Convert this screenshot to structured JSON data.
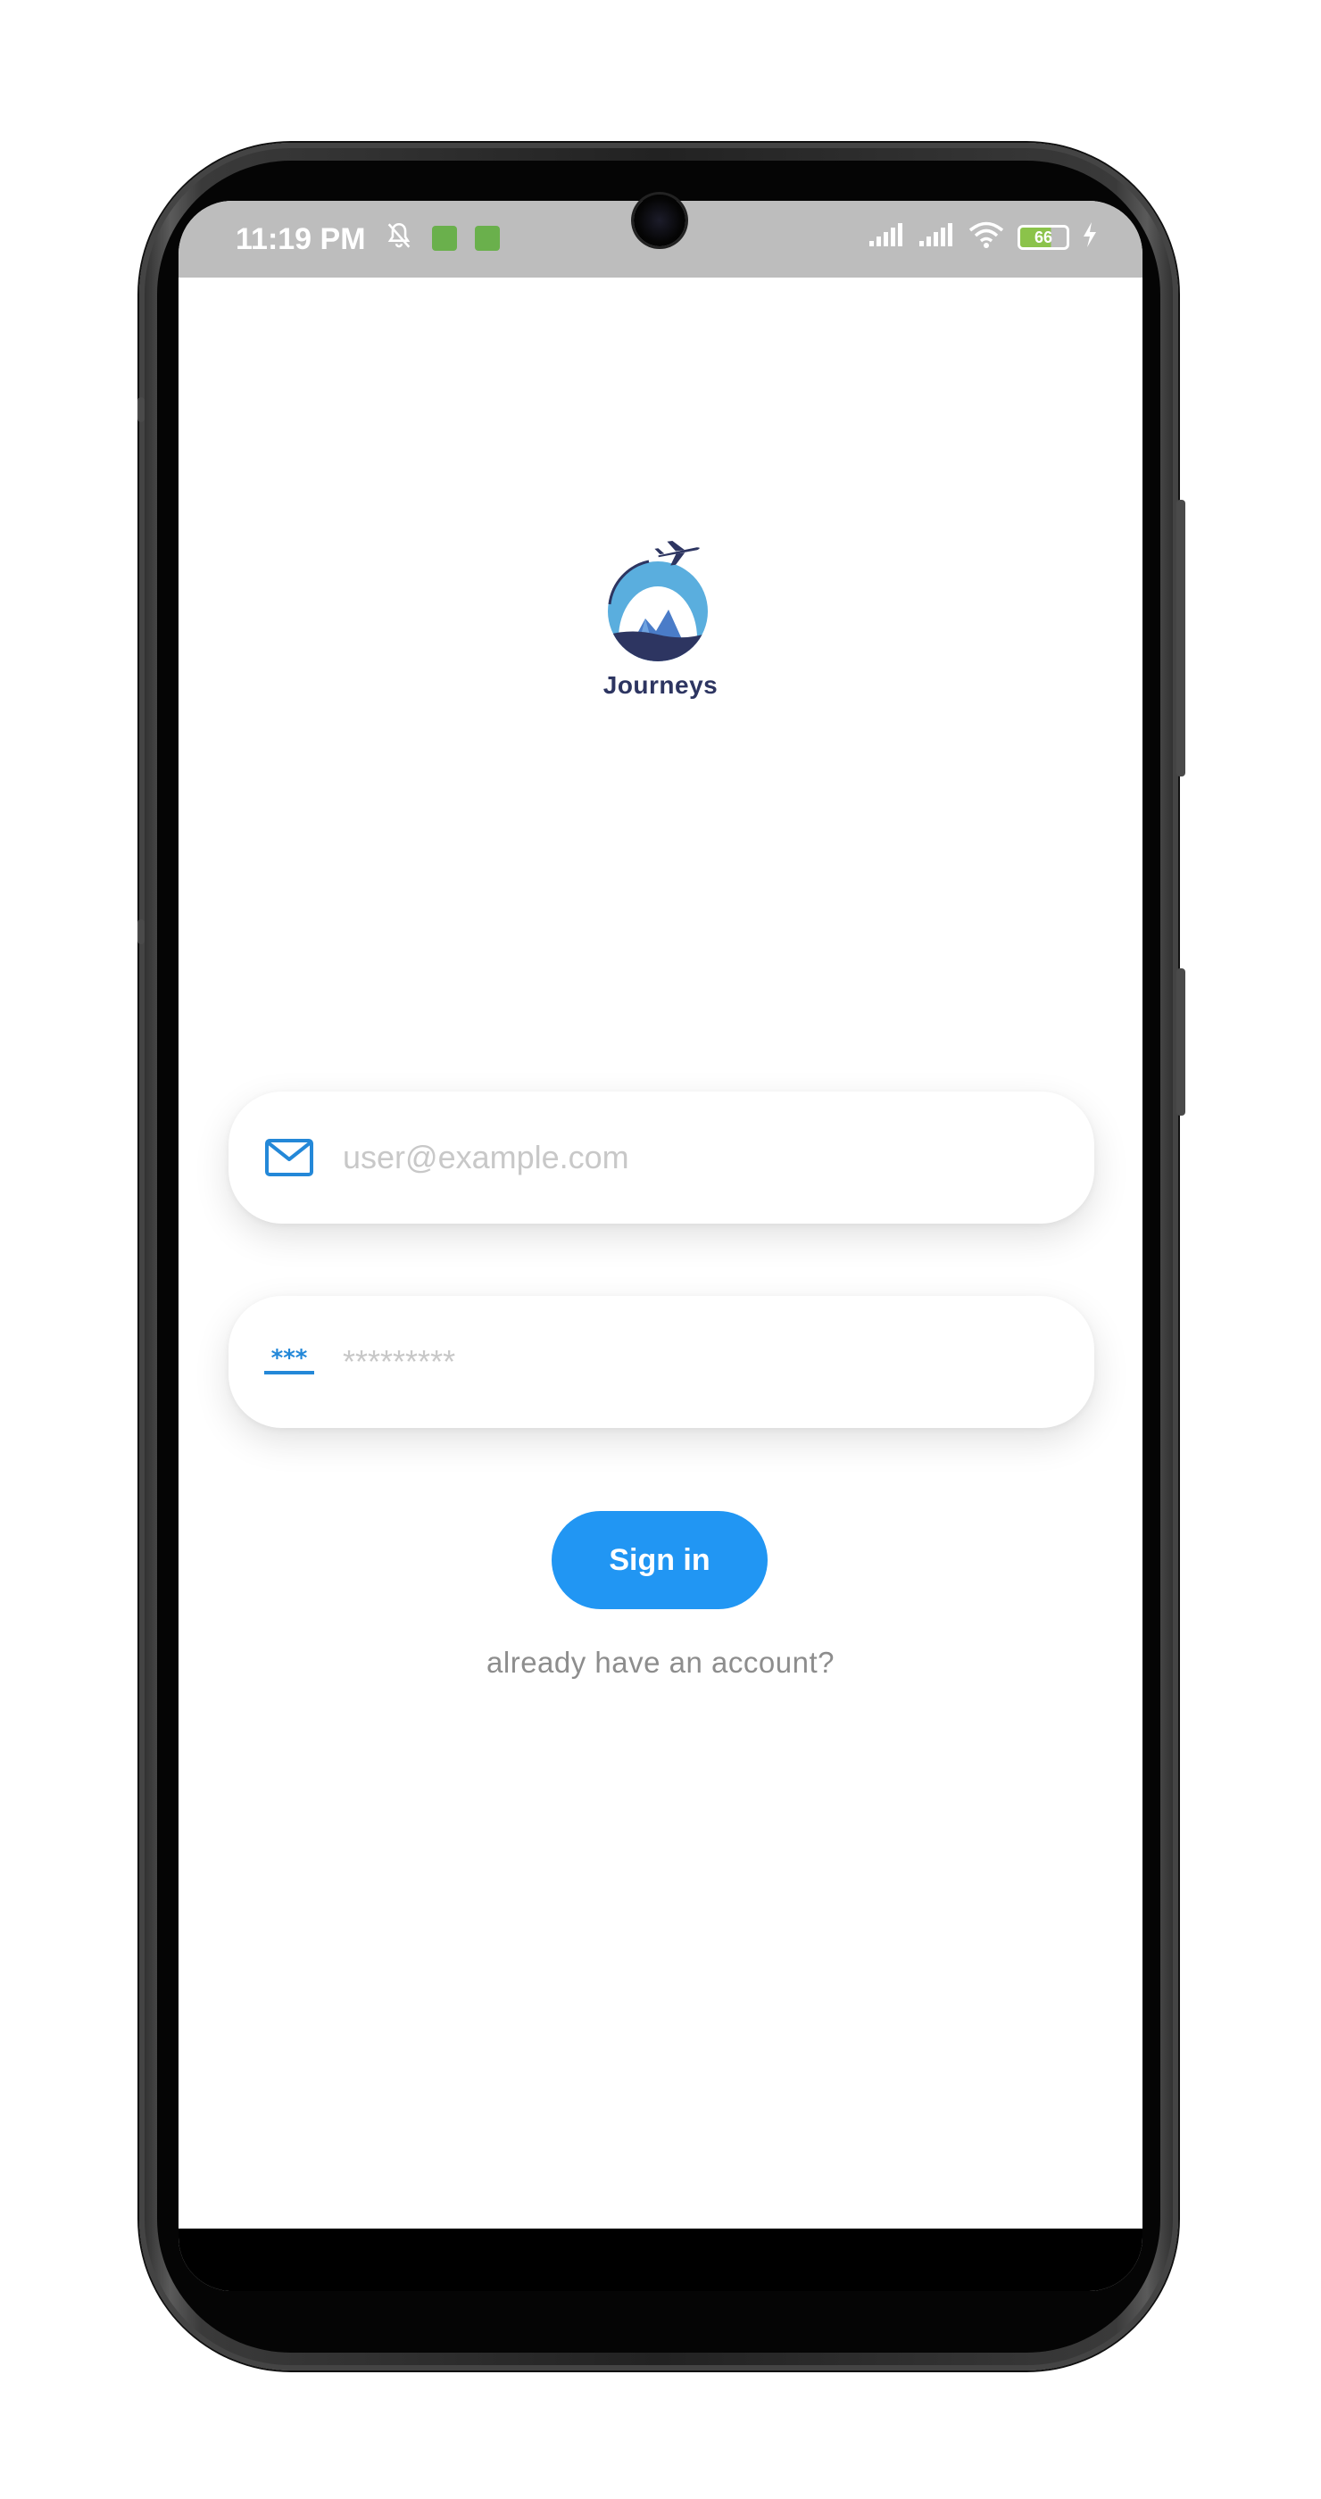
{
  "status_bar": {
    "time": "11:19 PM",
    "battery_level": "66"
  },
  "app": {
    "name": "Journeys"
  },
  "login_form": {
    "email_placeholder": "user@example.com",
    "password_placeholder": "*********",
    "sign_in_label": "Sign in",
    "account_link": "already have an account?"
  },
  "colors": {
    "accent": "#2196f3",
    "logo_dark": "#2d3561",
    "status_bar_bg": "#bdbdbd"
  },
  "icons": {
    "email": "mail-icon",
    "password": "password-asterisk-icon",
    "logo": "journeys-logo"
  }
}
